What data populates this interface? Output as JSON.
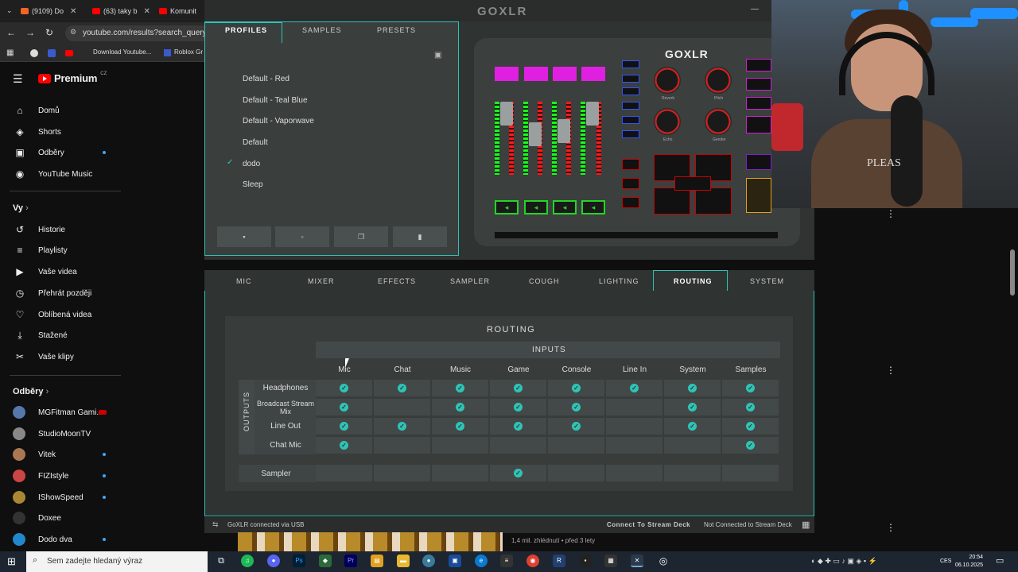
{
  "browser": {
    "tabs": [
      {
        "label": "(9109) Do"
      },
      {
        "label": "(63) taky b"
      },
      {
        "label": "Komunit"
      }
    ],
    "url": "youtube.com/results?search_query=c",
    "bookmarks": [
      "Download Youtube...",
      "Roblox Gr"
    ]
  },
  "youtube": {
    "brand": "Premium",
    "region": "CZ",
    "nav": [
      {
        "label": "Domů",
        "icon": "home-icon"
      },
      {
        "label": "Shorts",
        "icon": "shorts-icon"
      },
      {
        "label": "Odběry",
        "icon": "subscriptions-icon"
      },
      {
        "label": "YouTube Music",
        "icon": "music-icon"
      }
    ],
    "you_title": "Vy",
    "you_items": [
      {
        "label": "Historie",
        "icon": "history-icon"
      },
      {
        "label": "Playlisty",
        "icon": "playlist-icon"
      },
      {
        "label": "Vaše videa",
        "icon": "video-icon"
      },
      {
        "label": "Přehrát později",
        "icon": "clock-icon"
      },
      {
        "label": "Oblíbená videa",
        "icon": "thumb-up-icon"
      },
      {
        "label": "Stažené",
        "icon": "download-icon"
      },
      {
        "label": "Vaše klipy",
        "icon": "scissors-icon"
      }
    ],
    "subs_title": "Odběry",
    "subs": [
      {
        "label": "MGFitman Gami...",
        "color": "#5577aa",
        "live": true
      },
      {
        "label": "StudioMoonTV",
        "color": "#888888"
      },
      {
        "label": "Vitek",
        "color": "#aa7755"
      },
      {
        "label": "FIZIstyle",
        "color": "#cc4444"
      },
      {
        "label": "IShowSpeed",
        "color": "#aa8833"
      },
      {
        "label": "Doxee",
        "color": "#333333"
      },
      {
        "label": "Dodo dva",
        "color": "#2288cc"
      }
    ],
    "views": "1,4 mil. zhlédnutí • před 3 lety"
  },
  "goxlr": {
    "title": "GOXLR",
    "profile_tabs": [
      "PROFILES",
      "SAMPLES",
      "PRESETS"
    ],
    "profiles": [
      {
        "label": "Default - Red",
        "selected": false
      },
      {
        "label": "Default - Teal Blue",
        "selected": false
      },
      {
        "label": "Default - Vaporwave",
        "selected": false
      },
      {
        "label": "Default",
        "selected": false
      },
      {
        "label": "dodo",
        "selected": true
      },
      {
        "label": "Sleep",
        "selected": false
      }
    ],
    "device_logo": "GOXLR",
    "knob_labels": [
      "Reverb",
      "Pitch",
      "Echo",
      "Gender"
    ],
    "mixer_tabs": [
      "MIC",
      "MIXER",
      "EFFECTS",
      "SAMPLER",
      "COUGH",
      "LIGHTING",
      "ROUTING",
      "SYSTEM"
    ],
    "active_tab": "ROUTING",
    "routing": {
      "title": "ROUTING",
      "inputs_label": "INPUTS",
      "outputs_label": "OUTPUTS",
      "columns": [
        "Mic",
        "Chat",
        "Music",
        "Game",
        "Console",
        "Line In",
        "System",
        "Samples"
      ],
      "rows": [
        {
          "label": "Headphones",
          "routes": [
            true,
            true,
            true,
            true,
            true,
            true,
            true,
            true
          ]
        },
        {
          "label": "Broadcast Stream Mix",
          "routes": [
            true,
            false,
            true,
            true,
            true,
            false,
            true,
            true
          ]
        },
        {
          "label": "Line Out",
          "routes": [
            true,
            true,
            true,
            true,
            true,
            false,
            true,
            true
          ]
        },
        {
          "label": "Chat Mic",
          "routes": [
            true,
            false,
            false,
            false,
            false,
            false,
            false,
            true
          ]
        }
      ],
      "sampler": {
        "label": "Sampler",
        "routes": [
          false,
          false,
          false,
          true,
          false,
          false,
          false,
          false
        ]
      }
    },
    "status_left": "GoXLR connected via USB",
    "stream_deck_btn": "Connect To Stream Deck",
    "stream_deck_status": "Not Connected to Stream Deck"
  },
  "taskbar": {
    "search_placeholder": "Sem zadejte hledaný výraz",
    "lang": "CES",
    "time": "20:54",
    "date": "06.10.2025"
  }
}
